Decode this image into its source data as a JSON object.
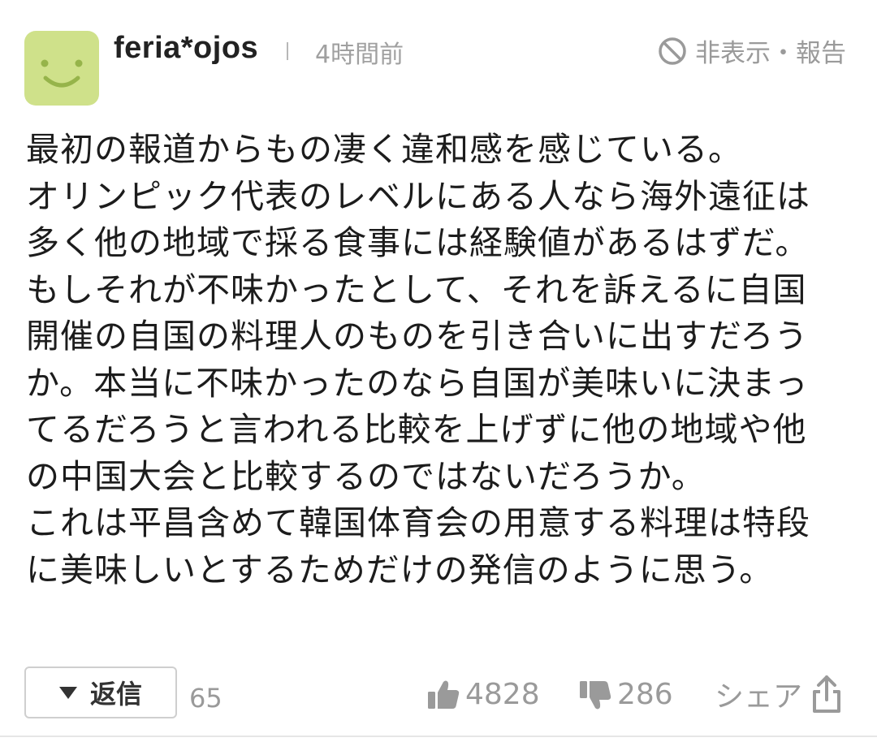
{
  "comment": {
    "author": "feria*ojos",
    "time": "4時間前",
    "hide_report": "非表示・報告",
    "avatar_icon": "smiley-face-icon",
    "avatar_color": "#cfe18a",
    "body_lines": [
      "最初の報道からもの凄く違和感を感じている。",
      "オリンピック代表のレベルにある人なら海外遠征は",
      "多く他の地域で採る食事には経験値があるはずだ。",
      "もしそれが不味かったとして、それを訴えるに自国",
      "開催の自国の料理人のものを引き合いに出すだろう",
      "か。本当に不味かったのなら自国が美味いに決まっ",
      "てるだろうと言われる比較を上げずに他の地域や他",
      "の中国大会と比較するのではないだろうか。",
      "これは平昌含めて韓国体育会の用意する料理は特段",
      "に美味しいとするためだけの発信のように思う。"
    ]
  },
  "footer": {
    "reply_label": "返信",
    "reply_count": "65",
    "like_count": "4828",
    "dislike_count": "286",
    "share_label": "シェア"
  }
}
